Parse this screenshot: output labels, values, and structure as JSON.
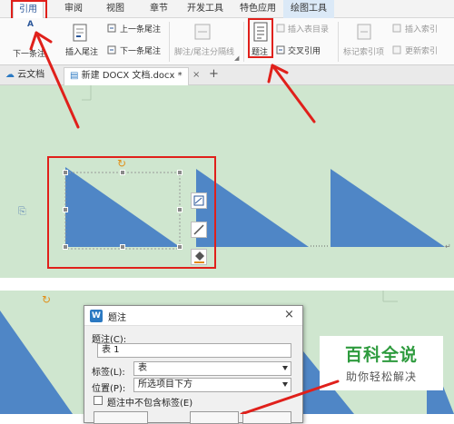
{
  "ribbon_tabs": [
    {
      "label": "引用",
      "active": true
    },
    {
      "label": "审阅"
    },
    {
      "label": "视图"
    },
    {
      "label": "章节"
    },
    {
      "label": "开发工具"
    },
    {
      "label": "特色应用"
    },
    {
      "label": "绘图工具"
    }
  ],
  "ribbon": {
    "partial_left_a": "A",
    "partial_left_b": "下一条注",
    "insert_footnote": "插入尾注",
    "prev_footnote": "上一条尾注",
    "next_footnote": "下一条尾注",
    "separator_line": "脚注/尾注分隔线",
    "caption": "题注",
    "insert_table_of_figures": "插入表目录",
    "cross_reference": "交叉引用",
    "mark_index_entry": "标记索引项",
    "insert_index": "插入索引",
    "update_index": "更新索引"
  },
  "doc_tabs": {
    "cloud": "云文档",
    "doc_name": "新建 DOCX 文档.docx *",
    "close": "×",
    "add": "+"
  },
  "dialog": {
    "title": "题注",
    "caption_label": "题注(C):",
    "caption_value": "表 1",
    "label_label": "标签(L):",
    "label_value": "表",
    "position_label": "位置(P):",
    "position_value": "所选项目下方",
    "exclude_label": "题注中不包含标签(E)",
    "close_icon": "×"
  },
  "watermark": {
    "title": "百科全说",
    "subtitle": "助你轻松解决"
  },
  "colors": {
    "doc_background": "#cfe6cf",
    "shape_fill": "#4f86c6",
    "annotation_red": "#e0201b",
    "watermark_green": "#2e9b3e"
  }
}
